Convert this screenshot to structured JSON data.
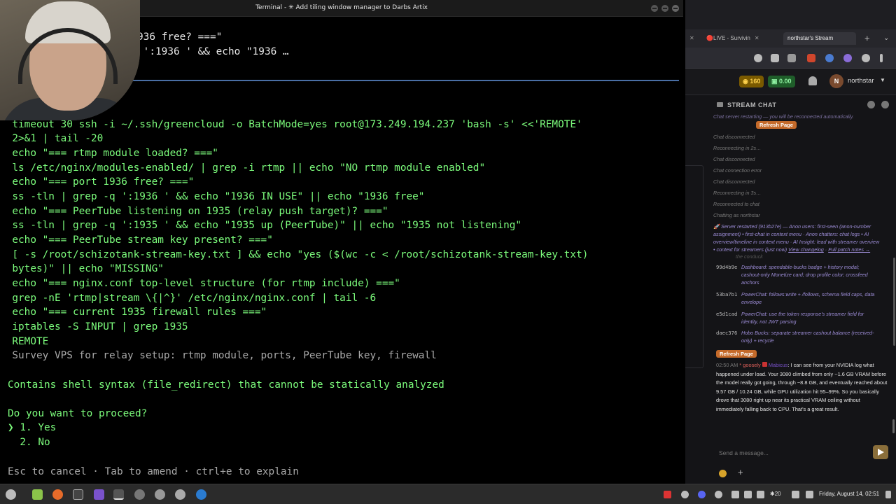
{
  "terminal": {
    "window_title": "Terminal - ✳ Add tiling window manager to Darbs Artix",
    "header_lines": [
      "936 free? ===\"",
      " ':1936 ' && echo \"1936 …"
    ],
    "lines": [
      "  timeout 30 ssh -i ~/.ssh/greencloud -o BatchMode=yes root@173.249.194.237 'bash -s' <<'REMOTE'",
      "  2>&1 | tail -20",
      "  echo \"=== rtmp module loaded? ===\"",
      "  ls /etc/nginx/modules-enabled/ | grep -i rtmp || echo \"NO rtmp module enabled\"",
      "  echo \"=== port 1936 free? ===\"",
      "  ss -tln | grep -q ':1936 ' && echo \"1936 IN USE\" || echo \"1936 free\"",
      "  echo \"=== PeerTube listening on 1935 (relay push target)? ===\"",
      "  ss -tln | grep -q ':1935 ' && echo \"1935 up (PeerTube)\" || echo \"1935 not listening\"",
      "  echo \"=== PeerTube stream key present? ===\"",
      "  [ -s /root/schizotank-stream-key.txt ] && echo \"yes ($(wc -c < /root/schizotank-stream-key.txt)",
      "  bytes)\" || echo \"MISSING\"",
      "  echo \"=== nginx.conf top-level structure (for rtmp include) ===\"",
      "  grep -nE 'rtmp|stream \\{|^}' /etc/nginx/nginx.conf | tail -6",
      "  echo \"=== current 1935 firewall rules ===\"",
      "  iptables -S INPUT | grep 1935",
      "  REMOTE"
    ],
    "description": "  Survey VPS for relay setup: rtmp module, ports, PeerTube key, firewall",
    "warning": "Contains shell syntax (file_redirect) that cannot be statically analyzed",
    "prompt": "Do you want to proceed?",
    "option_yes": "❯ 1. Yes",
    "option_no": "  2. No",
    "hint": "Esc to cancel · Tab to amend · ctrl+e to explain"
  },
  "browser": {
    "tabs": [
      {
        "label": "🔴LIVE - Survivin"
      },
      {
        "label": "northstar's Stream"
      }
    ],
    "site": {
      "bucks": "160",
      "money": "0.00",
      "username": "northstar"
    },
    "chat": {
      "title": "STREAM CHAT",
      "messages": [
        {
          "text": "Chat server restarting — you will be reconnected automatically.",
          "kind": "sys"
        },
        {
          "text": "Chat disconnected",
          "kind": "grey"
        },
        {
          "text": "Reconnecting in 2s…",
          "kind": "grey"
        },
        {
          "text": "Chat disconnected",
          "kind": "grey"
        },
        {
          "text": "Chat connection error",
          "kind": "grey"
        },
        {
          "text": "Chat disconnected",
          "kind": "grey"
        },
        {
          "text": "Reconnecting in 3s…",
          "kind": "grey"
        },
        {
          "text": "Reconnected to chat",
          "kind": "grey"
        },
        {
          "text": "Chatting as northstar",
          "kind": "grey"
        }
      ],
      "refresh_label": "Refresh Page",
      "patch_note": "🚀 Server restarted (913b27e) — Anon users: first-seen (anon-number assignment) • first-chat in context menu · Anon chatters: chat logs • AI overview/timeline in context menu · AI Insight: lead with streamer overview • context for streamers (just now)",
      "patch_link": "View changelog",
      "patch_link2": "Full patch notes →",
      "cutoff": "the conduck",
      "commits": [
        {
          "hash": "99d4b9e",
          "text": "Dashboard: spendable-bucks badge + history modal; cashout-only Monetize card; drop profile color; crossfeed anchors"
        },
        {
          "hash": "53ba7b1",
          "text": "PowerChat: follows:write + /follows, schema field caps, data envelope"
        },
        {
          "hash": "e5d1cad",
          "text": "PowerChat: use the token response's streamer field for identity, not JWT parsing"
        },
        {
          "hash": "daec376",
          "text": "Hobo Bucks: separate streamer cashout balance (received-only) + recycle"
        }
      ],
      "user_message": {
        "time": "02:50 AM",
        "tag": "goosely",
        "name": "Mabicus",
        "text": "I can see from your NVIDIA log what happened under load. Your 3080 climbed from only ~1.6 GB VRAM before the model really got going, through ~8.8 GB, and eventually reached about 9.57 GB / 10.24 GB, while GPU utilization hit 95–99%. So you basically drove that 3080 right up near its practical VRAM ceiling without immediately falling back to CPU. That's a great result."
      },
      "input_placeholder": "Send a message..."
    }
  },
  "taskbar": {
    "clock": "Friday, August 14, 02:51",
    "tray_number": "20"
  },
  "colors": {
    "terminal_green": "#7cfc7c",
    "accent_orange": "#c46a2a",
    "chat_purple": "#9c8cd6"
  }
}
